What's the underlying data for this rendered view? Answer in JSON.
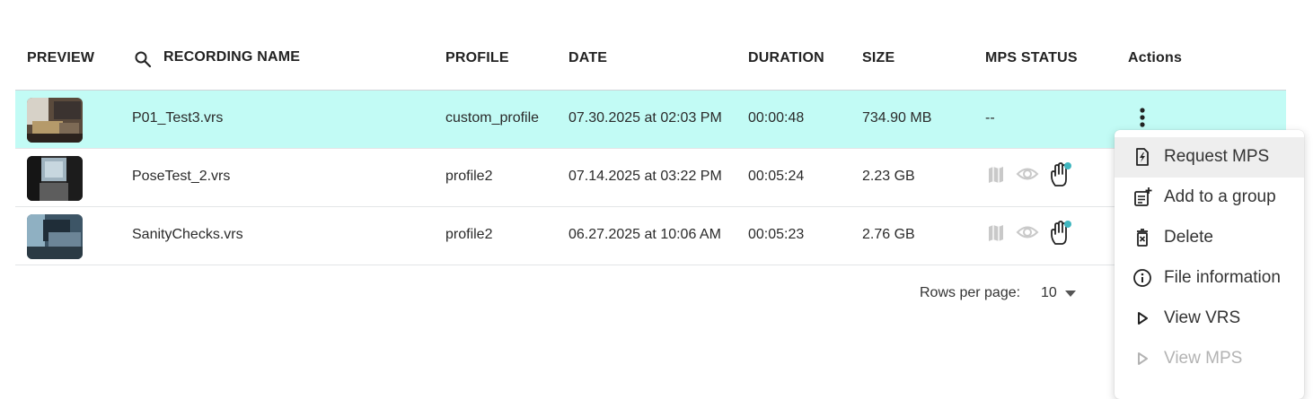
{
  "table": {
    "columns": {
      "preview": "PREVIEW",
      "recording_name": "RECORDING NAME",
      "profile": "PROFILE",
      "date": "DATE",
      "duration": "DURATION",
      "size": "SIZE",
      "mps_status": "MPS STATUS",
      "actions": "Actions"
    },
    "rows": [
      {
        "name": "P01_Test3.vrs",
        "profile": "custom_profile",
        "date": "07.30.2025 at 02:03 PM",
        "duration": "00:00:48",
        "size": "734.90 MB",
        "mps_status": "--",
        "selected": true
      },
      {
        "name": "PoseTest_2.vrs",
        "profile": "profile2",
        "date": "07.14.2025 at 03:22 PM",
        "duration": "00:05:24",
        "size": "2.23 GB",
        "mps_status_icons": [
          "map-icon",
          "eye-icon",
          "hand-icon"
        ]
      },
      {
        "name": "SanityChecks.vrs",
        "profile": "profile2",
        "date": "06.27.2025 at 10:06 AM",
        "duration": "00:05:23",
        "size": "2.76 GB",
        "mps_status_icons": [
          "map-icon",
          "eye-icon",
          "hand-icon"
        ]
      }
    ]
  },
  "pagination": {
    "rows_per_page_label": "Rows per page:",
    "rows_per_page_value": "10"
  },
  "context_menu": {
    "items": [
      {
        "label": "Request MPS",
        "icon": "request-mps-icon",
        "state": "hover"
      },
      {
        "label": "Add to a group",
        "icon": "add-to-group-icon"
      },
      {
        "label": "Delete",
        "icon": "trash-icon"
      },
      {
        "label": "File information",
        "icon": "info-icon"
      },
      {
        "label": "View VRS",
        "icon": "play-icon"
      },
      {
        "label": "View MPS",
        "icon": "play-icon",
        "state": "disabled"
      }
    ]
  },
  "colors": {
    "selected_row": "#c2fbf5",
    "status_dot": "#3fb6bf",
    "inactive_icon": "#c9c9c9"
  }
}
